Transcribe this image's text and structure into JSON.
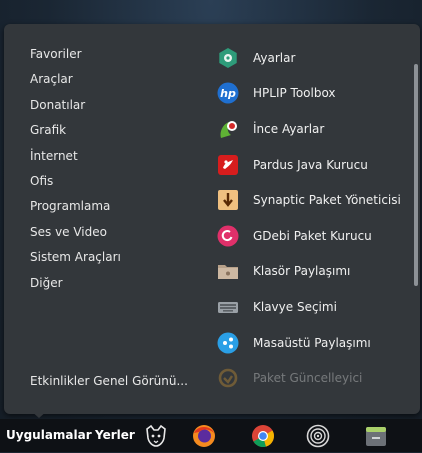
{
  "menu": {
    "categories": [
      {
        "label": "Favoriler"
      },
      {
        "label": "Araçlar"
      },
      {
        "label": "Donatılar"
      },
      {
        "label": "Grafik"
      },
      {
        "label": "İnternet"
      },
      {
        "label": "Ofis"
      },
      {
        "label": "Programlama"
      },
      {
        "label": "Ses ve Video"
      },
      {
        "label": "Sistem Araçları"
      },
      {
        "label": "Diğer"
      }
    ],
    "overview_label": "Etkinlikler Genel Görünü...",
    "apps": [
      {
        "label": "Ayarlar",
        "icon": "settings-icon"
      },
      {
        "label": "HPLIP Toolbox",
        "icon": "hp-icon"
      },
      {
        "label": "İnce Ayarlar",
        "icon": "tweaks-icon"
      },
      {
        "label": "Pardus Java Kurucu",
        "icon": "java-installer-icon"
      },
      {
        "label": "Synaptic Paket Yöneticisi",
        "icon": "synaptic-icon"
      },
      {
        "label": "GDebi Paket Kurucu",
        "icon": "gdebi-icon"
      },
      {
        "label": "Klasör Paylaşımı",
        "icon": "folder-share-icon"
      },
      {
        "label": "Klavye Seçimi",
        "icon": "keyboard-icon"
      },
      {
        "label": "Masaüstü Paylaşımı",
        "icon": "desktop-share-icon"
      },
      {
        "label": "Paket Güncelleyici",
        "icon": "package-updater-icon"
      }
    ]
  },
  "taskbar": {
    "applications_label": "Uygulamalar",
    "places_label": "Yerler",
    "icons": [
      "pardus-logo-icon",
      "firefox-icon",
      "chrome-icon",
      "disk-icon",
      "files-icon"
    ]
  },
  "colors": {
    "menu_bg": "#33373b",
    "taskbar_bg": "#0e1115",
    "text": "#e8e8e8"
  }
}
